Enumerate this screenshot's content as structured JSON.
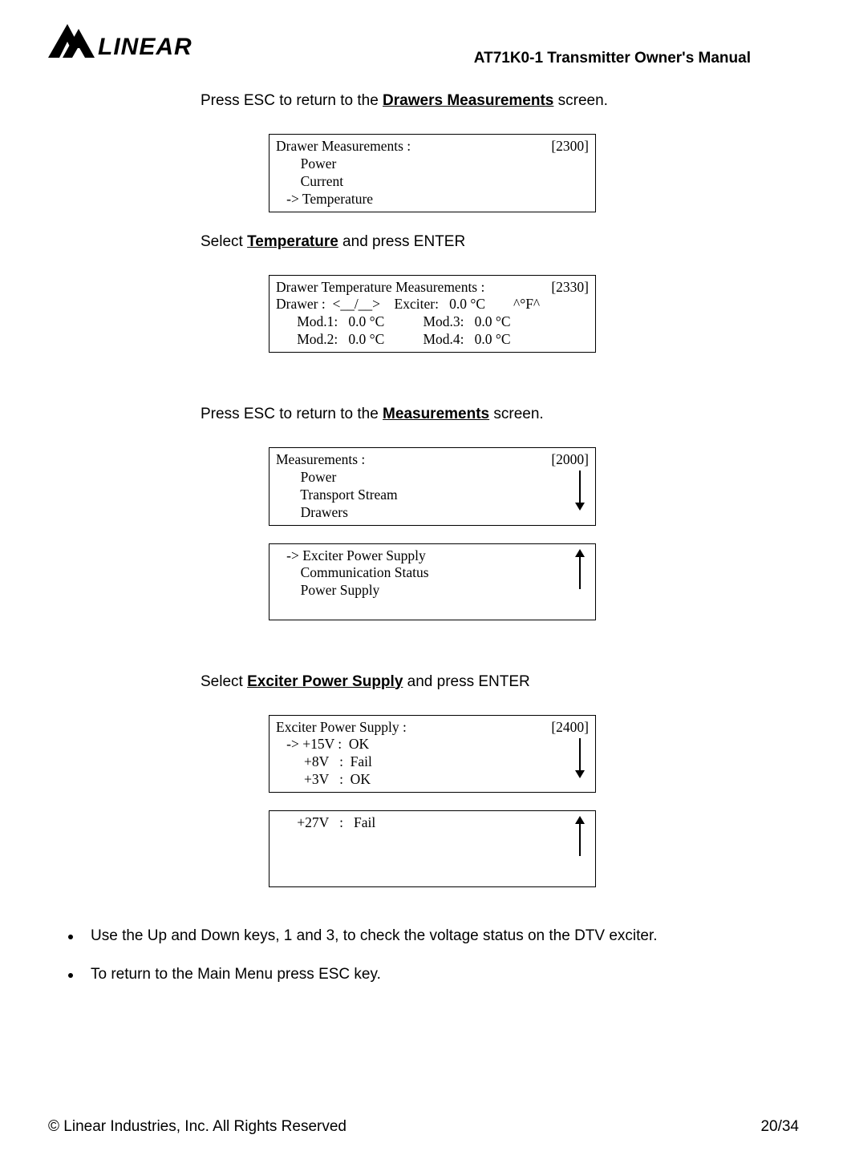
{
  "header": {
    "brand": "LINEAR",
    "title": "AT71K0-1 Transmitter Owner's Manual"
  },
  "instructions": {
    "line1_pre": "Press ESC to return to the ",
    "line1_bold": "Drawers Measurements",
    "line1_post": " screen.",
    "line2_pre": "Select ",
    "line2_bold": "Temperature",
    "line2_post": " and press ENTER",
    "line3_pre": "Press ESC to return to the ",
    "line3_bold": "Measurements",
    "line3_post": " screen.",
    "line4_pre": "Select ",
    "line4_bold": "Exciter Power Supply",
    "line4_post": " and press ENTER"
  },
  "lcd1": {
    "r1l": "Drawer Measurements :",
    "r1r": "[2300]",
    "r2": "       Power",
    "r3": "       Current",
    "r4": "   -> Temperature"
  },
  "lcd2": {
    "r1l": "Drawer Temperature Measurements :",
    "r1r": "[2330]",
    "r2": "Drawer :  <__/__>    Exciter:   0.0 °C        ^°F^",
    "r3": "      Mod.1:   0.0 °C           Mod.3:   0.0 °C",
    "r4": "      Mod.2:   0.0 °C           Mod.4:   0.0 °C"
  },
  "lcd3": {
    "r1l": "Measurements :",
    "r1r": "[2000]",
    "r2": "       Power",
    "r3": "       Transport Stream",
    "r4": "       Drawers"
  },
  "lcd4": {
    "r1": "   -> Exciter Power Supply",
    "r2": "       Communication Status",
    "r3": "       Power Supply"
  },
  "lcd5": {
    "r1l": "Exciter Power Supply :",
    "r1r": "[2400]",
    "r2": "   -> +15V :  OK",
    "r3": "        +8V   :  Fail",
    "r4": "        +3V   :  OK"
  },
  "lcd6": {
    "r1": "      +27V   :   Fail"
  },
  "bullets": {
    "b1": "Use the Up and Down keys, 1 and 3, to check the voltage status on the DTV exciter.",
    "b2": "To return to the Main Menu press ESC key."
  },
  "footer": {
    "left": "© Linear Industries, Inc. All Rights Reserved",
    "right": "20/34"
  },
  "chart_data": {
    "type": "table",
    "title": "AT71K0-1 Transmitter LCD menu screens",
    "screens": [
      {
        "name": "Drawer Measurements",
        "code": 2300,
        "items": [
          "Power",
          "Current",
          "Temperature"
        ],
        "selected": "Temperature"
      },
      {
        "name": "Drawer Temperature Measurements",
        "code": 2330,
        "drawer": "<__/__>",
        "unit_toggle": "°F",
        "readings": [
          {
            "label": "Exciter",
            "value": 0.0,
            "unit": "°C"
          },
          {
            "label": "Mod.1",
            "value": 0.0,
            "unit": "°C"
          },
          {
            "label": "Mod.2",
            "value": 0.0,
            "unit": "°C"
          },
          {
            "label": "Mod.3",
            "value": 0.0,
            "unit": "°C"
          },
          {
            "label": "Mod.4",
            "value": 0.0,
            "unit": "°C"
          }
        ]
      },
      {
        "name": "Measurements",
        "code": 2000,
        "items": [
          "Power",
          "Transport Stream",
          "Drawers",
          "Exciter Power Supply",
          "Communication Status",
          "Power Supply"
        ],
        "selected": "Exciter Power Supply"
      },
      {
        "name": "Exciter Power Supply",
        "code": 2400,
        "readings": [
          {
            "label": "+15V",
            "status": "OK"
          },
          {
            "label": "+8V",
            "status": "Fail"
          },
          {
            "label": "+3V",
            "status": "OK"
          },
          {
            "label": "+27V",
            "status": "Fail"
          }
        ],
        "selected": "+15V"
      }
    ]
  }
}
